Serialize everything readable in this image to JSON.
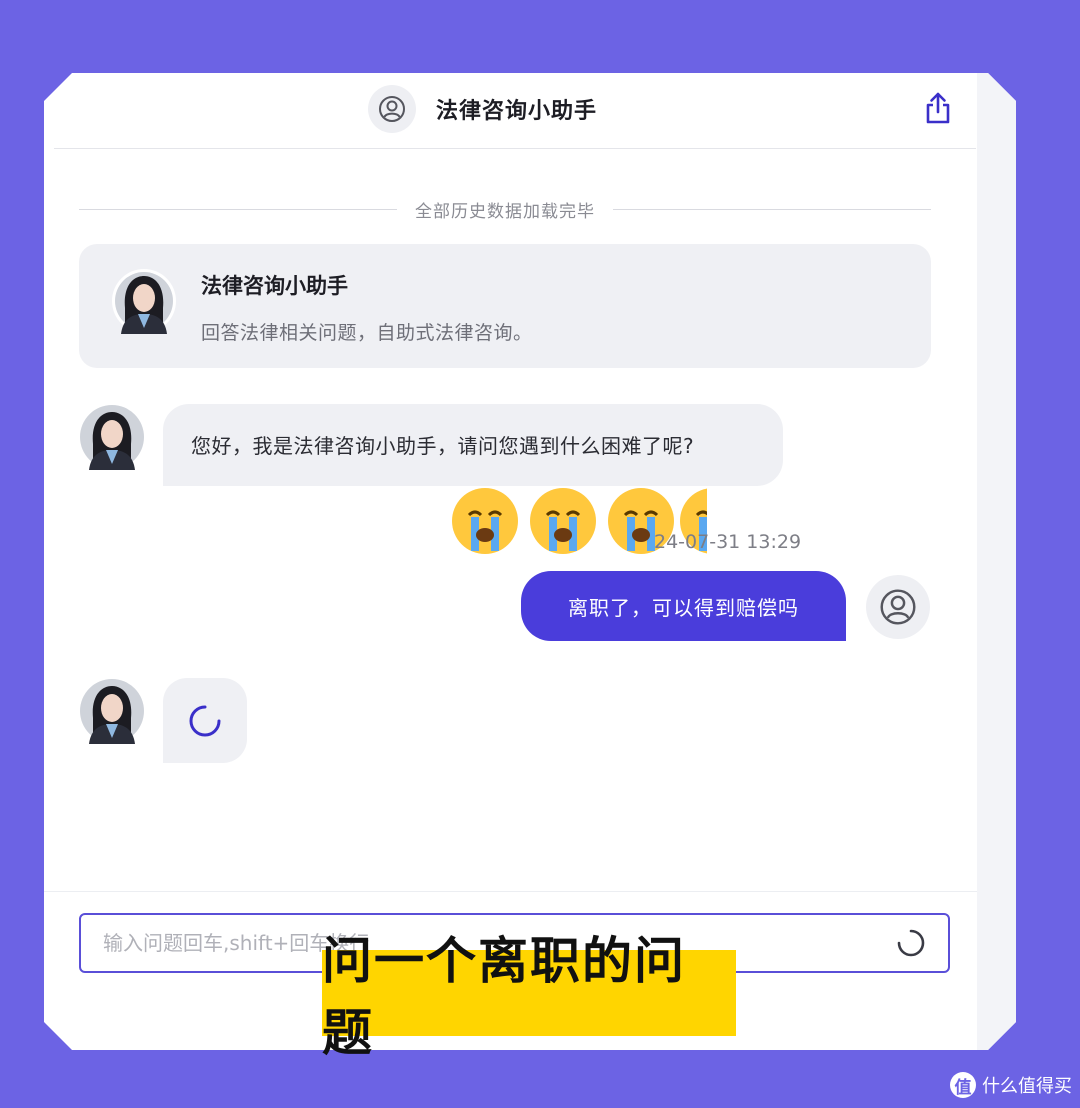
{
  "header": {
    "title": "法律咨询小助手"
  },
  "history_divider": "全部历史数据加载完毕",
  "intro_card": {
    "title": "法律咨询小助手",
    "description": "回答法律相关问题，自助式法律咨询。"
  },
  "messages": {
    "bot_greeting": "您好，我是法律咨询小助手，请问您遇到什么困难了呢?",
    "timestamp": "24-07-31 13:29",
    "user_message": "离职了，可以得到赔偿吗"
  },
  "input": {
    "placeholder": "输入问题回车,shift+回车换行",
    "value": ""
  },
  "caption": "问一个离职的问题",
  "watermark": "什么值得买",
  "watermark_logo": "值",
  "colors": {
    "background": "#6c63e4",
    "accent": "#4a3ddb",
    "bubble_gray": "#eff0f4",
    "caption_yellow": "#ffd500"
  }
}
